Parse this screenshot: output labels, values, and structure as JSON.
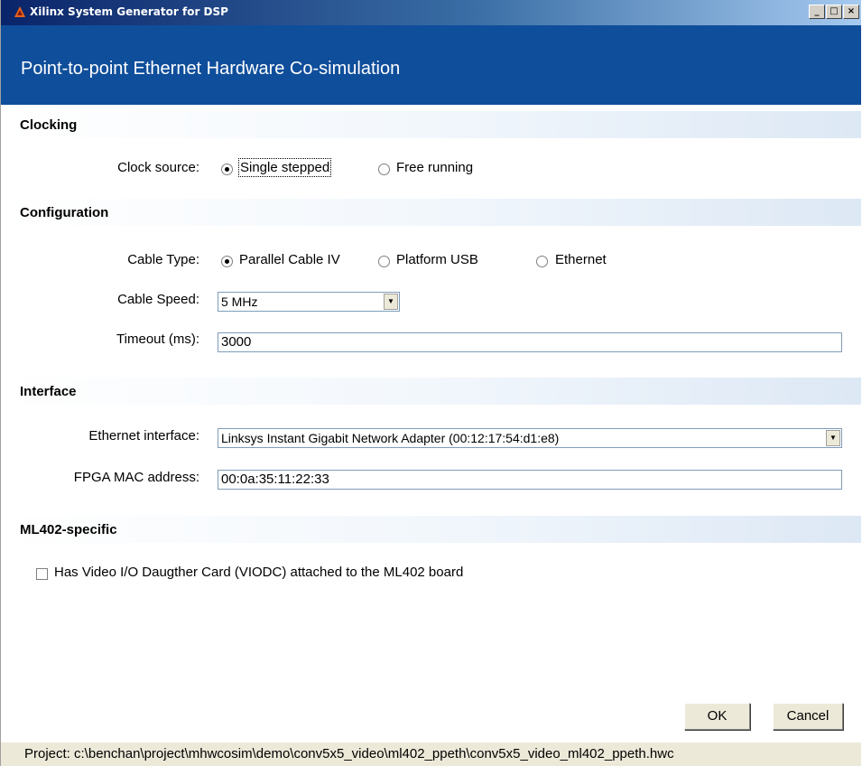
{
  "window": {
    "title": "Xilinx System Generator for DSP",
    "controls": {
      "minimize": "_",
      "maximize": "□",
      "close": "×"
    }
  },
  "header": {
    "title": "Point-to-point Ethernet Hardware Co-simulation"
  },
  "clocking": {
    "section_title": "Clocking",
    "clock_source_label": "Clock source:",
    "options": [
      "Single stepped",
      "Free running"
    ],
    "selected": "Single stepped"
  },
  "configuration": {
    "section_title": "Configuration",
    "cable_type_label": "Cable Type:",
    "cable_type_options": [
      "Parallel Cable IV",
      "Platform USB",
      "Ethernet"
    ],
    "cable_type_selected": "Parallel Cable IV",
    "cable_speed_label": "Cable Speed:",
    "cable_speed_value": "5 MHz",
    "timeout_label": "Timeout (ms):",
    "timeout_value": "3000"
  },
  "interface": {
    "section_title": "Interface",
    "ethernet_interface_label": "Ethernet interface:",
    "ethernet_interface_value": "Linksys Instant Gigabit Network Adapter (00:12:17:54:d1:e8)",
    "fpga_mac_label": "FPGA MAC address:",
    "fpga_mac_value": "00:0a:35:11:22:33"
  },
  "ml402": {
    "section_title": "ML402-specific",
    "viodc_checkbox_label": "Has Video I/O Daugther Card (VIODC) attached to the ML402 board",
    "viodc_checked": false
  },
  "buttons": {
    "ok": "OK",
    "cancel": "Cancel"
  },
  "status": {
    "project_path": "Project: c:\\benchan\\project\\mhwcosim\\demo\\conv5x5_video\\ml402_ppeth\\conv5x5_video_ml402_ppeth.hwc"
  }
}
